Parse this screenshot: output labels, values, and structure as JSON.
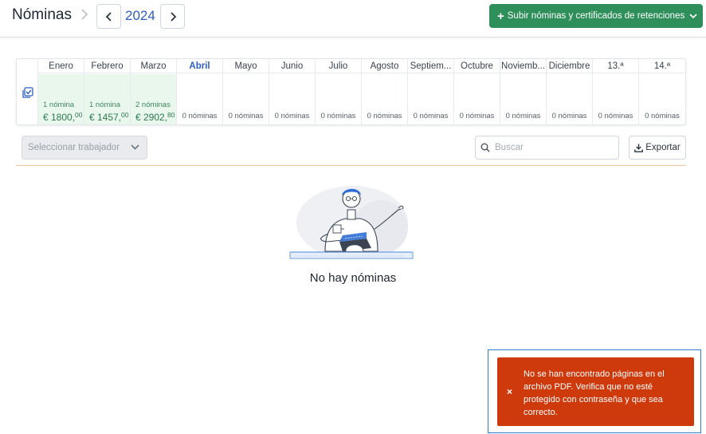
{
  "header": {
    "title": "Nóminas",
    "year": "2024",
    "upload_label": "Subir nóminas y certificados de retenciones"
  },
  "months": [
    {
      "name": "Enero",
      "count": "1 nómina",
      "amount": "€ 1800,",
      "cents": "00",
      "filled": true
    },
    {
      "name": "Febrero",
      "count": "1 nómina",
      "amount": "€ 1457,",
      "cents": "00",
      "filled": true
    },
    {
      "name": "Marzo",
      "count": "2 nóminas",
      "amount": "€ 2902,",
      "cents": "80",
      "filled": true
    },
    {
      "name": "Abril",
      "empty": "0 nóminas",
      "active": true
    },
    {
      "name": "Mayo",
      "empty": "0 nóminas"
    },
    {
      "name": "Junio",
      "empty": "0 nóminas"
    },
    {
      "name": "Julio",
      "empty": "0 nóminas"
    },
    {
      "name": "Agosto",
      "empty": "0 nóminas"
    },
    {
      "name": "Septiem...",
      "empty": "0 nóminas"
    },
    {
      "name": "Octubre",
      "empty": "0 nóminas"
    },
    {
      "name": "Noviemb...",
      "empty": "0 nóminas"
    },
    {
      "name": "Diciembre",
      "empty": "0 nóminas"
    },
    {
      "name": "13.ª",
      "empty": "0 nóminas"
    },
    {
      "name": "14.ª",
      "empty": "0 nóminas"
    }
  ],
  "filters": {
    "worker_placeholder": "Seleccionar trabajador",
    "search_placeholder": "Buscar",
    "export_label": "Exportar"
  },
  "empty_state": {
    "title": "No hay nóminas"
  },
  "toast": {
    "message": "No se han encontrado páginas en el archivo PDF. Verifica que no esté protegido con contraseña y que sea correcto.",
    "close": "×"
  },
  "colors": {
    "accent": "#2f5dbd",
    "primary_button": "#2f8f5b",
    "filled_month": "#eaf7ec",
    "error_toast": "#cf3a0d",
    "divider": "#f1c597"
  }
}
